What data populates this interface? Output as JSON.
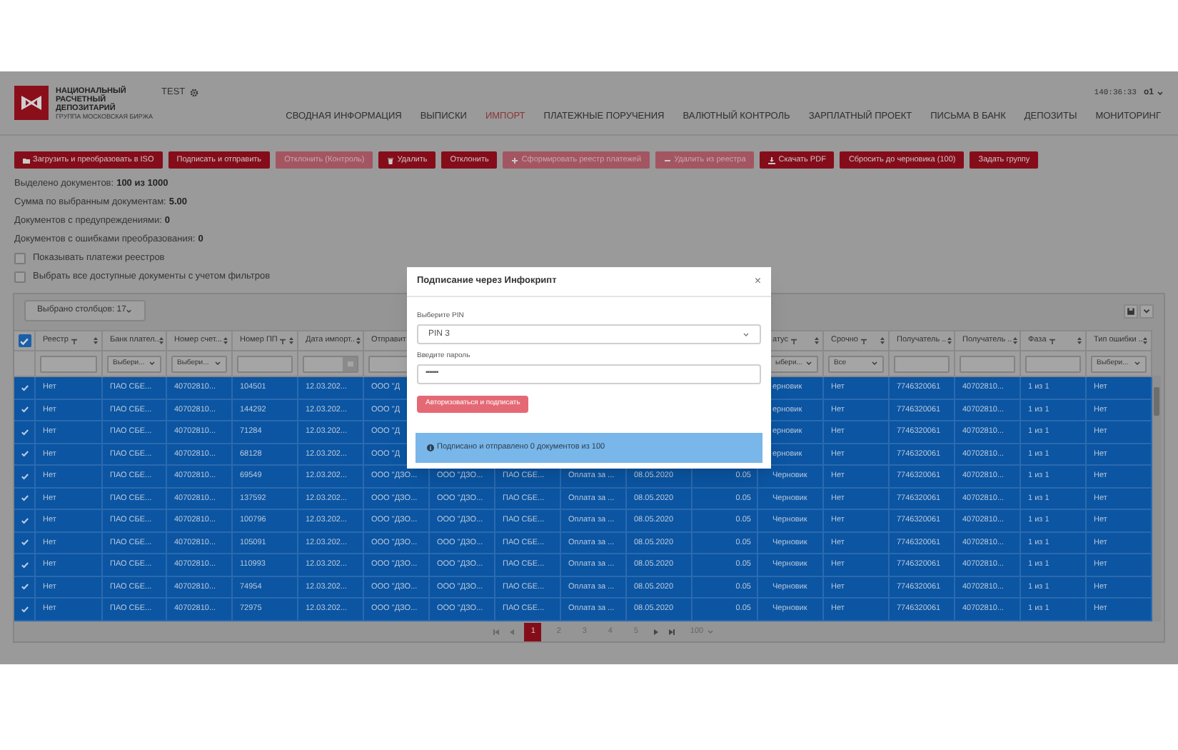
{
  "header": {
    "logo_lines": [
      "НАЦИОНАЛЬНЫЙ",
      "РАСЧЕТНЫЙ",
      "ДЕПОЗИТАРИЙ"
    ],
    "logo_tagline": "ГРУППА МОСКОВСКАЯ БИРЖА",
    "environment": "TEST",
    "timer": "140:36:33",
    "user": "о1"
  },
  "nav": [
    {
      "label": "СВОДНАЯ ИНФОРМАЦИЯ",
      "selected": false
    },
    {
      "label": "ВЫПИСКИ",
      "selected": false
    },
    {
      "label": "ИМПОРТ",
      "selected": true
    },
    {
      "label": "ПЛАТЕЖНЫЕ ПОРУЧЕНИЯ",
      "selected": false
    },
    {
      "label": "ВАЛЮТНЫЙ КОНТРОЛЬ",
      "selected": false
    },
    {
      "label": "ЗАРПЛАТНЫЙ ПРОЕКТ",
      "selected": false
    },
    {
      "label": "ПИСЬМА В БАНК",
      "selected": false
    },
    {
      "label": "ДЕПОЗИТЫ",
      "selected": false
    },
    {
      "label": "МОНИТОРИНГ",
      "selected": false
    }
  ],
  "toolbar": [
    {
      "kind": "folder",
      "label": "Загрузить и преобразовать в ISO",
      "disabled": false
    },
    {
      "kind": "plain",
      "label": "Подписать и отправить",
      "disabled": false
    },
    {
      "kind": "plain",
      "label": "Отклонить (Контроль)",
      "disabled": true
    },
    {
      "kind": "trash",
      "label": "Удалить",
      "disabled": false
    },
    {
      "kind": "plain",
      "label": "Отклонить",
      "disabled": false
    },
    {
      "kind": "plus",
      "label": "Сформировать реестр платежей",
      "disabled": true
    },
    {
      "kind": "minus",
      "label": "Удалить из реестра",
      "disabled": true
    },
    {
      "kind": "download",
      "label": "Скачать PDF",
      "disabled": false
    },
    {
      "kind": "plain",
      "label": "Сбросить до черновика (100)",
      "disabled": false
    },
    {
      "kind": "plain",
      "label": "Задать группу",
      "disabled": false
    }
  ],
  "summary": [
    {
      "label": "Выделено документов:",
      "value": "100 из 1000"
    },
    {
      "label": "Сумма по выбранным документам:",
      "value": "5.00"
    },
    {
      "label": "Документов с предупреждениями:",
      "value": "0"
    },
    {
      "label": "Документов с ошибками преобразования:",
      "value": "0"
    }
  ],
  "options": [
    {
      "label": "Показывать платежи реестров",
      "checked": false
    },
    {
      "label": "Выбрать все доступные документы с учетом фильтров",
      "checked": false
    }
  ],
  "table": {
    "columns_picker": "Выбрано столбцов: 17",
    "all_selected": true,
    "columns": [
      {
        "label": "Реестр",
        "filterable": true,
        "filter": {
          "kind": "text"
        }
      },
      {
        "label": "Банк плател..",
        "filterable": false,
        "filter": {
          "kind": "select",
          "value": "Выбери..."
        }
      },
      {
        "label": "Номер счет...",
        "filterable": false,
        "filter": {
          "kind": "select",
          "value": "Выбери..."
        }
      },
      {
        "label": "Номер ПП",
        "filterable": true,
        "filter": {
          "kind": "text"
        }
      },
      {
        "label": "Дата импорт..",
        "filterable": false,
        "filter": {
          "kind": "date"
        }
      },
      {
        "label": "Отправит",
        "filter": {
          "kind": "text"
        }
      },
      null,
      null,
      null,
      null,
      null,
      {
        "label": "атус",
        "filterable": true,
        "filter": {
          "kind": "select",
          "value": "ыбери..."
        }
      },
      {
        "label": "Срочно",
        "filterable": true,
        "filter": {
          "kind": "select",
          "value": "Все"
        }
      },
      {
        "label": "Получатель ..",
        "filterable": false,
        "filter": {
          "kind": "text"
        }
      },
      {
        "label": "Получатель ..",
        "filterable": false,
        "filter": {
          "kind": "text"
        }
      },
      {
        "label": "Фаза",
        "filterable": true,
        "filter": {
          "kind": "text"
        }
      },
      {
        "label": "Тип ошибки ..",
        "filterable": false,
        "filter": {
          "kind": "select",
          "value": "Выбери..."
        }
      }
    ],
    "rows": [
      {
        "selected": true,
        "cells": [
          "Нет",
          "ПАО СБЕ...",
          "40702810...",
          "104501",
          "12.03.202...",
          "ООО \"Д",
          null,
          null,
          null,
          null,
          null,
          "ерновик",
          "Нет",
          "7746320061",
          "40702810...",
          "1 из 1",
          "Нет"
        ]
      },
      {
        "selected": true,
        "cells": [
          "Нет",
          "ПАО СБЕ...",
          "40702810...",
          "144292",
          "12.03.202...",
          "ООО \"Д",
          null,
          null,
          null,
          null,
          null,
          "ерновик",
          "Нет",
          "7746320061",
          "40702810...",
          "1 из 1",
          "Нет"
        ]
      },
      {
        "selected": true,
        "cells": [
          "Нет",
          "ПАО СБЕ...",
          "40702810...",
          "71284",
          "12.03.202...",
          "ООО \"Д",
          null,
          null,
          null,
          null,
          null,
          "ерновик",
          "Нет",
          "7746320061",
          "40702810...",
          "1 из 1",
          "Нет"
        ]
      },
      {
        "selected": true,
        "cells": [
          "Нет",
          "ПАО СБЕ...",
          "40702810...",
          "68128",
          "12.03.202...",
          "ООО \"Д",
          null,
          null,
          null,
          null,
          null,
          "ерновик",
          "Нет",
          "7746320061",
          "40702810...",
          "1 из 1",
          "Нет"
        ]
      },
      {
        "selected": true,
        "cells": [
          "Нет",
          "ПАО СБЕ...",
          "40702810...",
          "69549",
          "12.03.202...",
          "ООО \"ДЗО...",
          "ООО \"ДЗО...",
          "ПАО СБЕ...",
          "Оплата за ...",
          "08.05.2020",
          "0.05",
          "Черновик",
          "Нет",
          "7746320061",
          "40702810...",
          "1 из 1",
          "Нет"
        ]
      },
      {
        "selected": true,
        "cells": [
          "Нет",
          "ПАО СБЕ...",
          "40702810...",
          "137592",
          "12.03.202...",
          "ООО \"ДЗО...",
          "ООО \"ДЗО...",
          "ПАО СБЕ...",
          "Оплата за ...",
          "08.05.2020",
          "0.05",
          "Черновик",
          "Нет",
          "7746320061",
          "40702810...",
          "1 из 1",
          "Нет"
        ]
      },
      {
        "selected": true,
        "cells": [
          "Нет",
          "ПАО СБЕ...",
          "40702810...",
          "100796",
          "12.03.202...",
          "ООО \"ДЗО...",
          "ООО \"ДЗО...",
          "ПАО СБЕ...",
          "Оплата за ...",
          "08.05.2020",
          "0.05",
          "Черновик",
          "Нет",
          "7746320061",
          "40702810...",
          "1 из 1",
          "Нет"
        ]
      },
      {
        "selected": true,
        "cells": [
          "Нет",
          "ПАО СБЕ...",
          "40702810...",
          "105091",
          "12.03.202...",
          "ООО \"ДЗО...",
          "ООО \"ДЗО...",
          "ПАО СБЕ...",
          "Оплата за ...",
          "08.05.2020",
          "0.05",
          "Черновик",
          "Нет",
          "7746320061",
          "40702810...",
          "1 из 1",
          "Нет"
        ]
      },
      {
        "selected": true,
        "cells": [
          "Нет",
          "ПАО СБЕ...",
          "40702810...",
          "110993",
          "12.03.202...",
          "ООО \"ДЗО...",
          "ООО \"ДЗО...",
          "ПАО СБЕ...",
          "Оплата за ...",
          "08.05.2020",
          "0.05",
          "Черновик",
          "Нет",
          "7746320061",
          "40702810...",
          "1 из 1",
          "Нет"
        ]
      },
      {
        "selected": true,
        "cells": [
          "Нет",
          "ПАО СБЕ...",
          "40702810...",
          "74954",
          "12.03.202...",
          "ООО \"ДЗО...",
          "ООО \"ДЗО...",
          "ПАО СБЕ...",
          "Оплата за ...",
          "08.05.2020",
          "0.05",
          "Черновик",
          "Нет",
          "7746320061",
          "40702810...",
          "1 из 1",
          "Нет"
        ]
      },
      {
        "selected": true,
        "cells": [
          "Нет",
          "ПАО СБЕ...",
          "40702810...",
          "72975",
          "12.03.202...",
          "ООО \"ДЗО...",
          "ООО \"ДЗО...",
          "ПАО СБЕ...",
          "Оплата за ...",
          "08.05.2020",
          "0.05",
          "Черновик",
          "Нет",
          "7746320061",
          "40702810...",
          "1 из 1",
          "Нет"
        ]
      }
    ],
    "pagination": {
      "pages": [
        {
          "label": "1",
          "selected": true
        },
        {
          "label": "2",
          "selected": false
        },
        {
          "label": "3",
          "selected": false
        },
        {
          "label": "4",
          "selected": false
        },
        {
          "label": "5",
          "selected": false
        }
      ],
      "page_size": "100"
    }
  },
  "modal": {
    "title": "Подписание через Инфокрипт",
    "close": "×",
    "pin_label": "Выберите PIN",
    "pin_value": "PIN 3",
    "password_label": "Введите пароль",
    "password_value": "•••••••",
    "submit": {
      "label": "Авторизоваться и подписать",
      "disabled": true
    },
    "info": "Подписано и отправлено 0 документов из 100"
  }
}
